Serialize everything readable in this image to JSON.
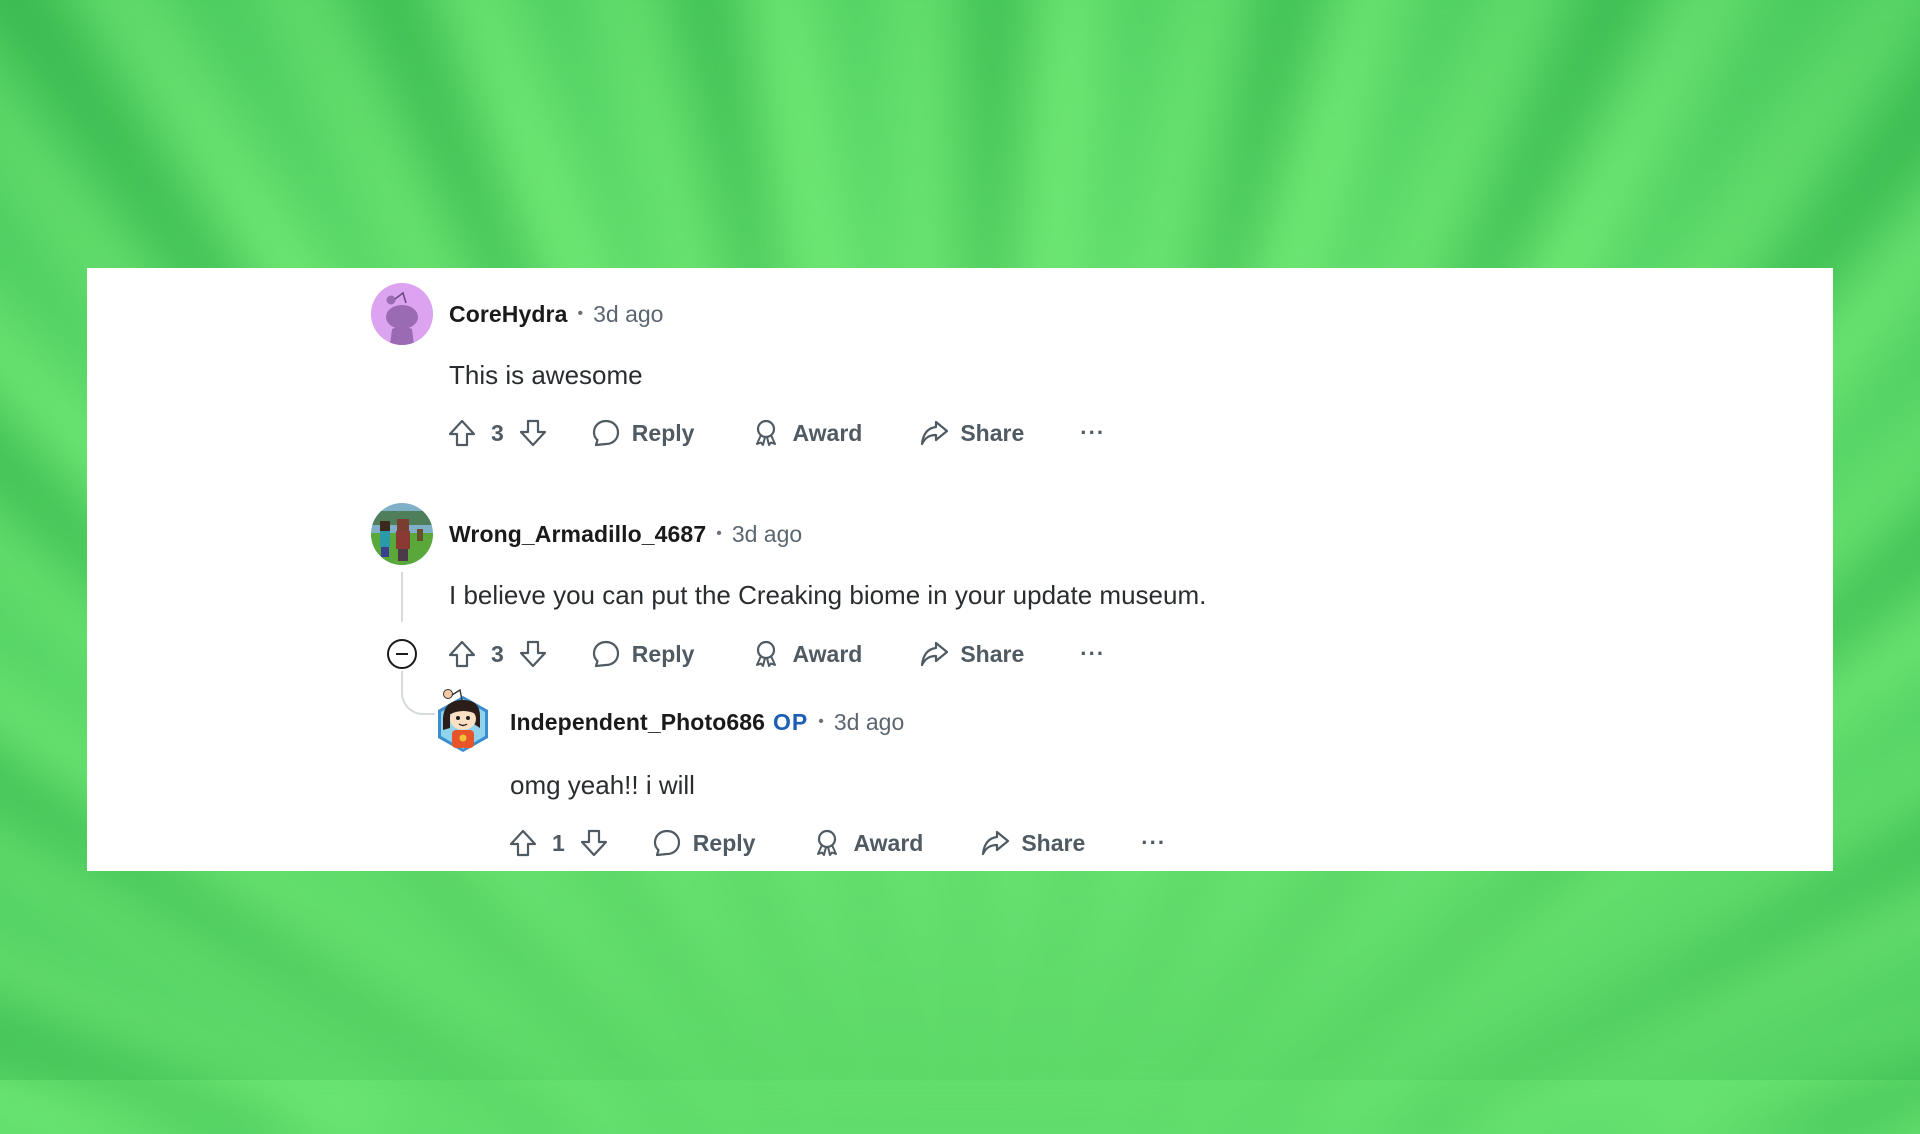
{
  "comments": [
    {
      "username": "CoreHydra",
      "is_op": false,
      "separator": "•",
      "time": "3d ago",
      "body": "This is awesome",
      "votes": "3",
      "actions": {
        "reply": "Reply",
        "award": "Award",
        "share": "Share",
        "more": "···"
      },
      "avatar_icon": "snoo-default-avatar",
      "avatar_color": "#dca4f0"
    },
    {
      "username": "Wrong_Armadillo_4687",
      "is_op": false,
      "separator": "•",
      "time": "3d ago",
      "body": "I believe you can put the Creaking biome in your update museum.",
      "votes": "3",
      "actions": {
        "reply": "Reply",
        "award": "Award",
        "share": "Share",
        "more": "···"
      },
      "avatar_icon": "minecraft-scene-avatar",
      "collapse_icon": "collapse-thread-icon",
      "replies": [
        {
          "username": "Independent_Photo686",
          "is_op": true,
          "op_label": "OP",
          "separator": "•",
          "time": "3d ago",
          "body": "omg yeah!! i will",
          "votes": "1",
          "actions": {
            "reply": "Reply",
            "award": "Award",
            "share": "Share",
            "more": "···"
          },
          "avatar_icon": "snoo-custom-avatar"
        }
      ]
    }
  ],
  "colors": {
    "op_badge": "#1c5fb5",
    "username": "#1a1a1b",
    "meta": "#5c6670",
    "action": "#4f5a62",
    "background_accent": "#5fdc6c"
  }
}
